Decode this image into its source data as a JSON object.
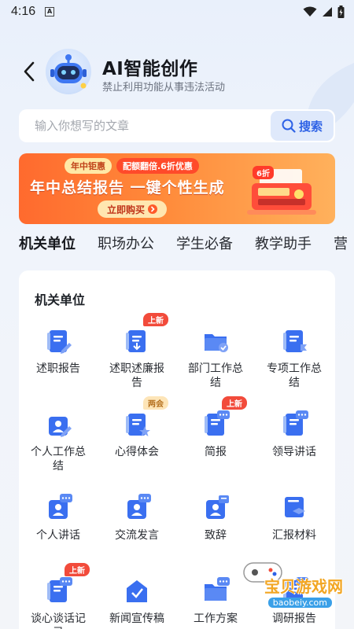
{
  "status": {
    "time": "4:16",
    "notif": "A"
  },
  "header": {
    "title": "AI智能创作",
    "subtitle": "禁止利用功能从事违法活动"
  },
  "search": {
    "placeholder": "输入你想写的文章",
    "button": "搜索"
  },
  "banner": {
    "tag1": "年中钜惠",
    "tag2": "配额翻倍.6折优惠",
    "headline": "年中总结报告 一键个性生成",
    "buy": "立即购买",
    "discount": "6折"
  },
  "tabs": [
    "机关单位",
    "职场办公",
    "学生必备",
    "教学助手",
    "营"
  ],
  "section": {
    "title": "机关单位",
    "items": [
      {
        "label": "述职报告",
        "icon": "report-edit-icon",
        "badge": ""
      },
      {
        "label": "述职述廉报告",
        "icon": "report-download-icon",
        "badge": "上新"
      },
      {
        "label": "部门工作总结",
        "icon": "folder-check-icon",
        "badge": ""
      },
      {
        "label": "专项工作总结",
        "icon": "document-flag-icon",
        "badge": ""
      },
      {
        "label": "个人工作总结",
        "icon": "person-edit-icon",
        "badge": ""
      },
      {
        "label": "心得体会",
        "icon": "document-star-icon",
        "badge": "两会"
      },
      {
        "label": "简报",
        "icon": "chat-document-icon",
        "badge": "上新"
      },
      {
        "label": "领导讲话",
        "icon": "document-chat-icon",
        "badge": ""
      },
      {
        "label": "个人讲话",
        "icon": "person-speech-icon",
        "badge": ""
      },
      {
        "label": "交流发言",
        "icon": "person-chat-icon",
        "badge": ""
      },
      {
        "label": "致辞",
        "icon": "person-note-icon",
        "badge": ""
      },
      {
        "label": "汇报材料",
        "icon": "stacked-layers-icon",
        "badge": ""
      },
      {
        "label": "谈心谈话记录",
        "icon": "pen-chat-icon",
        "badge": "上新"
      },
      {
        "label": "新闻宣传稿",
        "icon": "news-envelope-icon",
        "badge": ""
      },
      {
        "label": "工作方案",
        "icon": "folder-chat-icon",
        "badge": ""
      },
      {
        "label": "调研报告",
        "icon": "survey-chat-icon",
        "badge": ""
      }
    ]
  },
  "watermark": {
    "text": "宝贝游戏网",
    "url": "baobeiy.com"
  },
  "colors": {
    "accent": "#2e62e6",
    "badge_red": "#f24b3b",
    "icon_blue": "#3a6ff0"
  }
}
